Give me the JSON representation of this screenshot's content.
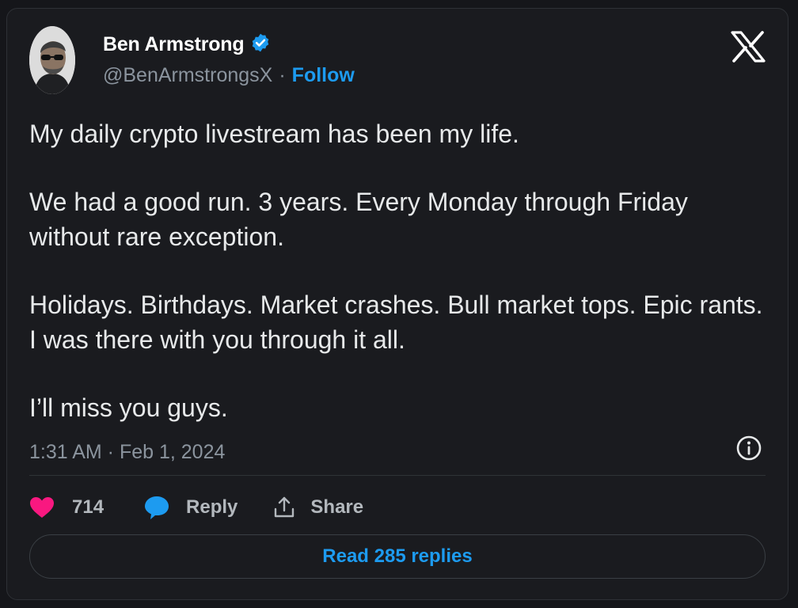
{
  "author": {
    "name": "Ben Armstrong",
    "handle": "@BenArmstrongsX",
    "separator": "·",
    "follow_label": "Follow",
    "verified": true
  },
  "tweet": {
    "paragraphs": [
      "My daily crypto livestream has been my life.",
      "We had a good run. 3 years. Every Monday through Friday without rare exception.",
      "Holidays. Birthdays. Market crashes. Bull market tops. Epic rants. I was there with you through it all.",
      "I’ll miss you guys."
    ],
    "timestamp": "1:31 AM · Feb 1, 2024"
  },
  "actions": {
    "like_count": "714",
    "reply_label": "Reply",
    "share_label": "Share"
  },
  "footer": {
    "read_replies_label": "Read 285 replies"
  },
  "icons": {
    "verified": "verified-badge-icon",
    "logo": "x-logo-icon",
    "info": "info-icon",
    "like": "heart-icon",
    "reply": "speech-bubble-icon",
    "share": "share-icon"
  },
  "colors": {
    "background": "#1a1b1f",
    "text": "#e7e9ea",
    "muted": "#8b949e",
    "accent": "#1d9bf0",
    "like": "#f91880"
  }
}
